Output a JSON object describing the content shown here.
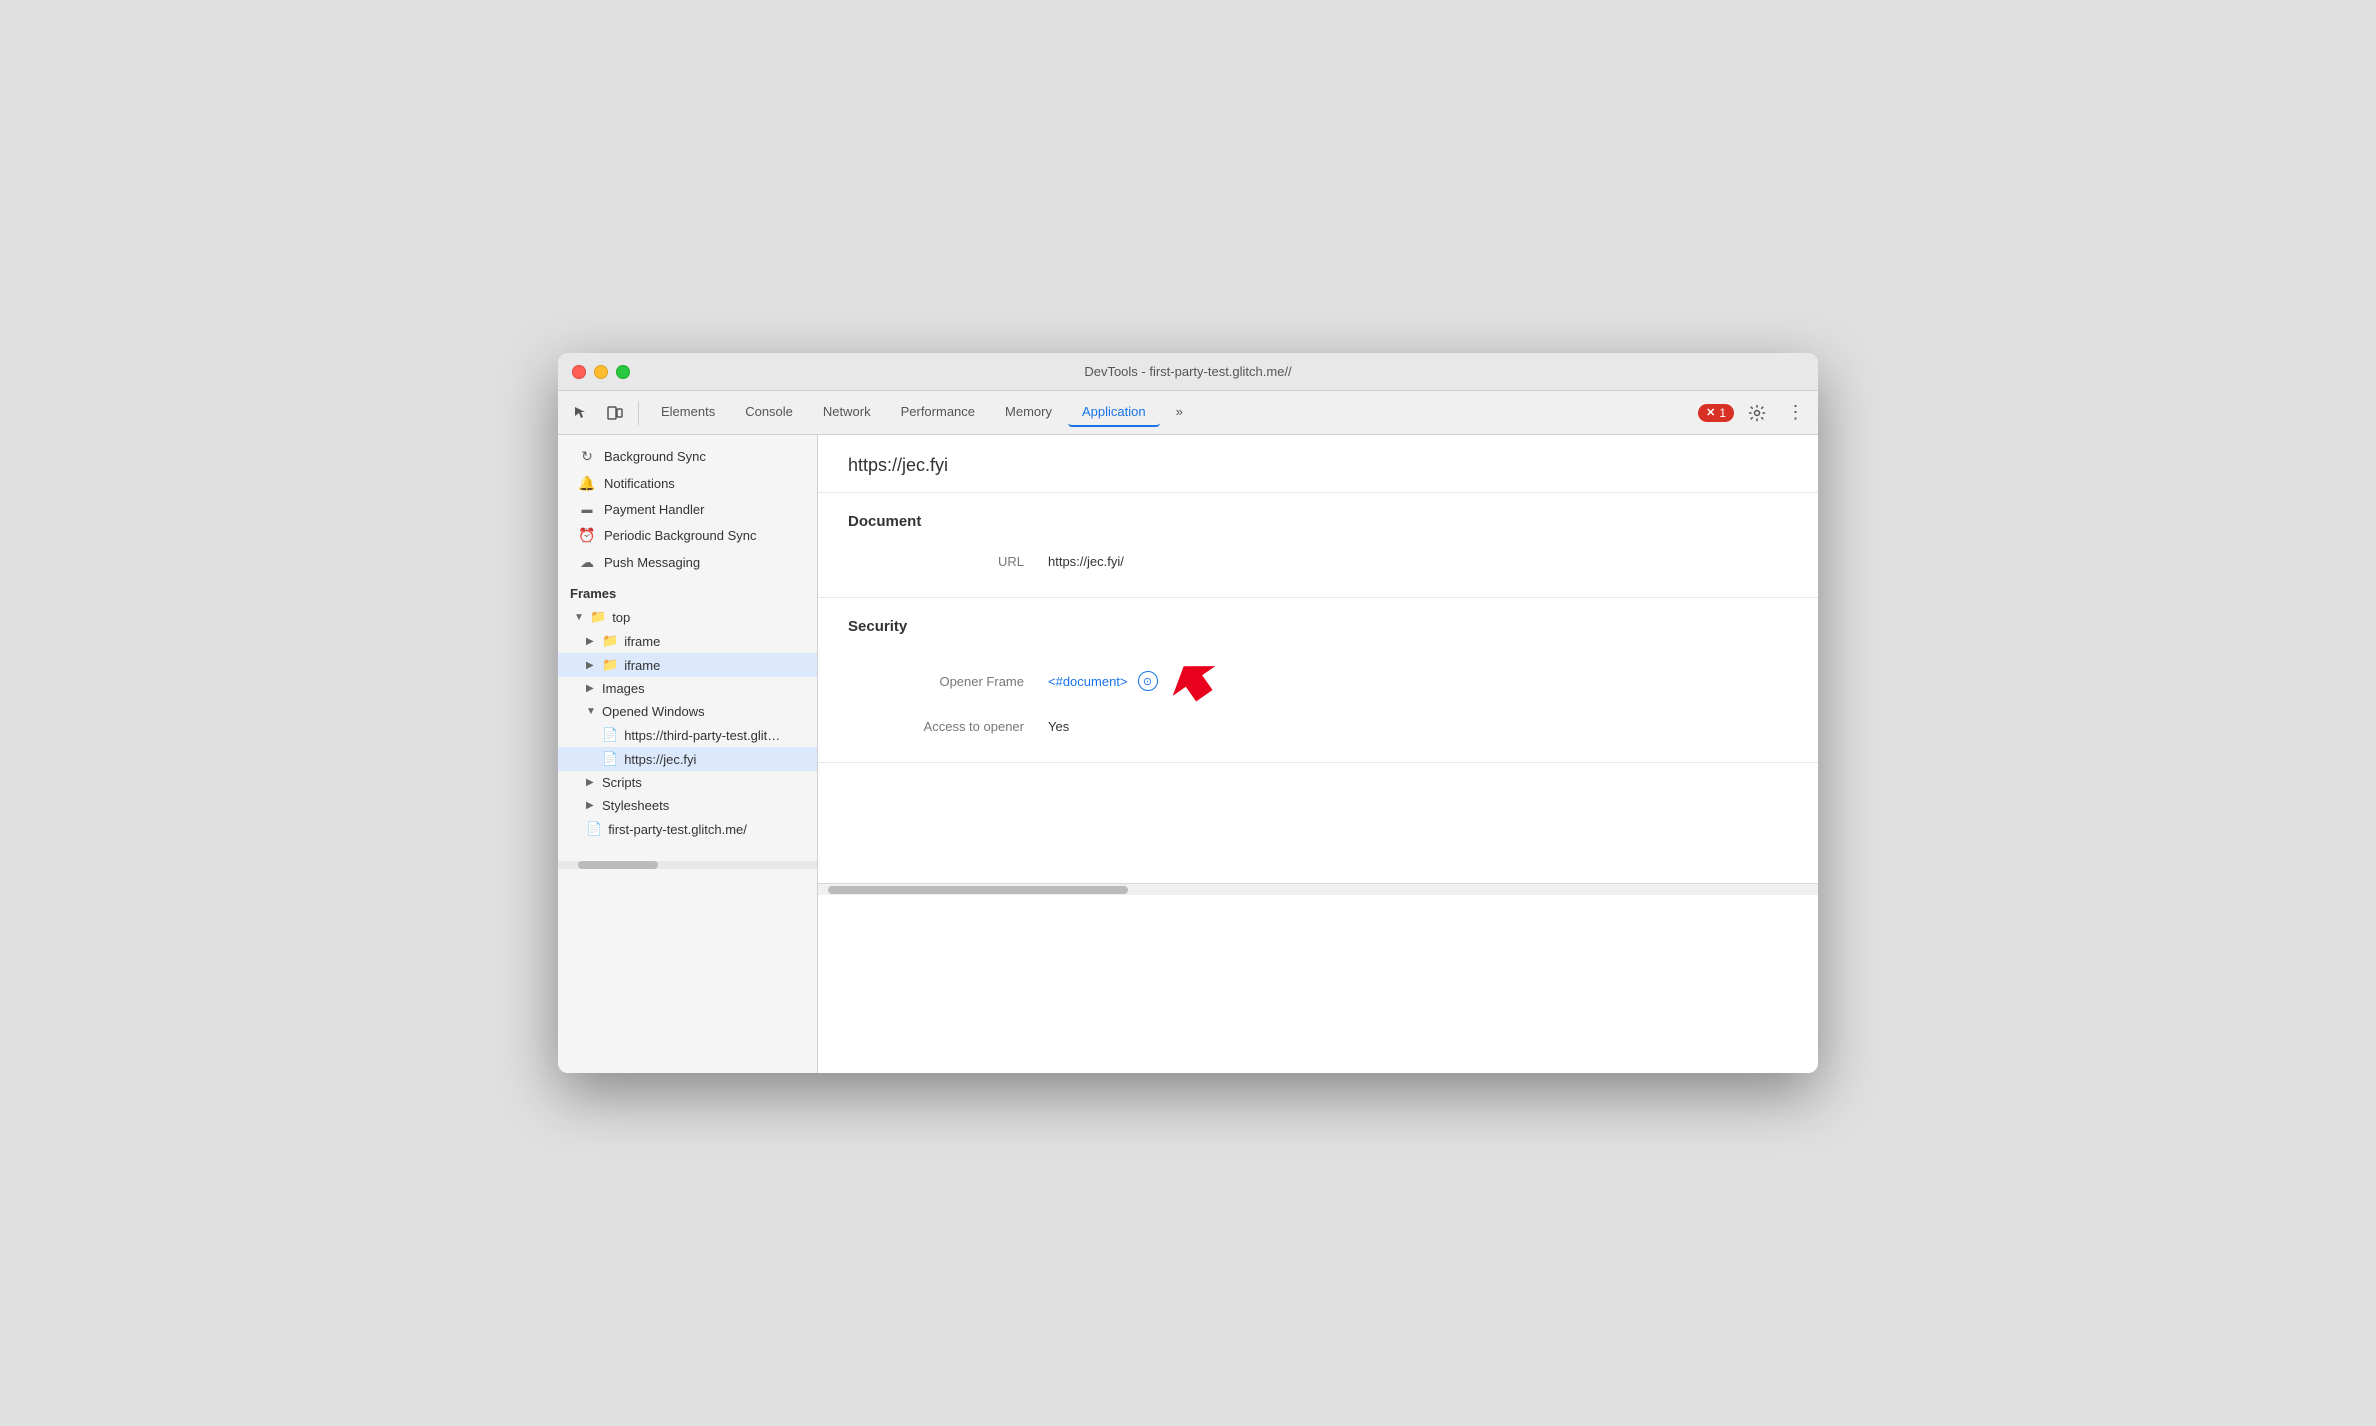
{
  "titlebar": {
    "title": "DevTools - first-party-test.glitch.me//"
  },
  "tabs": [
    {
      "id": "elements",
      "label": "Elements",
      "active": false
    },
    {
      "id": "console",
      "label": "Console",
      "active": false
    },
    {
      "id": "network",
      "label": "Network",
      "active": false
    },
    {
      "id": "performance",
      "label": "Performance",
      "active": false
    },
    {
      "id": "memory",
      "label": "Memory",
      "active": false
    },
    {
      "id": "application",
      "label": "Application",
      "active": true
    },
    {
      "id": "more",
      "label": "»",
      "active": false
    }
  ],
  "error_badge": {
    "count": "1"
  },
  "sidebar": {
    "items": [
      {
        "id": "background-sync",
        "icon": "↻",
        "label": "Background Sync"
      },
      {
        "id": "notifications",
        "icon": "🔔",
        "label": "Notifications"
      },
      {
        "id": "payment-handler",
        "icon": "▬",
        "label": "Payment Handler"
      },
      {
        "id": "periodic-bg-sync",
        "icon": "⏰",
        "label": "Periodic Background Sync"
      },
      {
        "id": "push-messaging",
        "icon": "☁",
        "label": "Push Messaging"
      }
    ],
    "frames_label": "Frames",
    "tree": {
      "top": {
        "label": "top",
        "children": [
          {
            "id": "iframe1",
            "label": "iframe",
            "selected": false
          },
          {
            "id": "iframe2",
            "label": "iframe",
            "selected": true
          },
          {
            "id": "images",
            "label": "Images",
            "selected": false
          },
          {
            "id": "opened-windows",
            "label": "Opened Windows",
            "children": [
              {
                "id": "ow1",
                "label": "https://third-party-test.glitch.me/po",
                "selected": false
              },
              {
                "id": "ow2",
                "label": "https://jec.fyi",
                "selected": true
              }
            ]
          },
          {
            "id": "scripts",
            "label": "Scripts",
            "selected": false
          },
          {
            "id": "stylesheets",
            "label": "Stylesheets",
            "selected": false
          },
          {
            "id": "first-party",
            "label": "first-party-test.glitch.me/",
            "selected": false
          }
        ]
      }
    }
  },
  "main": {
    "url": "https://jec.fyi",
    "document_section": {
      "title": "Document",
      "fields": [
        {
          "label": "URL",
          "value": "https://jec.fyi/"
        }
      ]
    },
    "security_section": {
      "title": "Security",
      "opener_frame_label": "Opener Frame",
      "opener_frame_link": "<#document>",
      "opener_frame_code_icon": "⓪",
      "access_to_opener_label": "Access to opener",
      "access_to_opener_value": "Yes"
    }
  }
}
